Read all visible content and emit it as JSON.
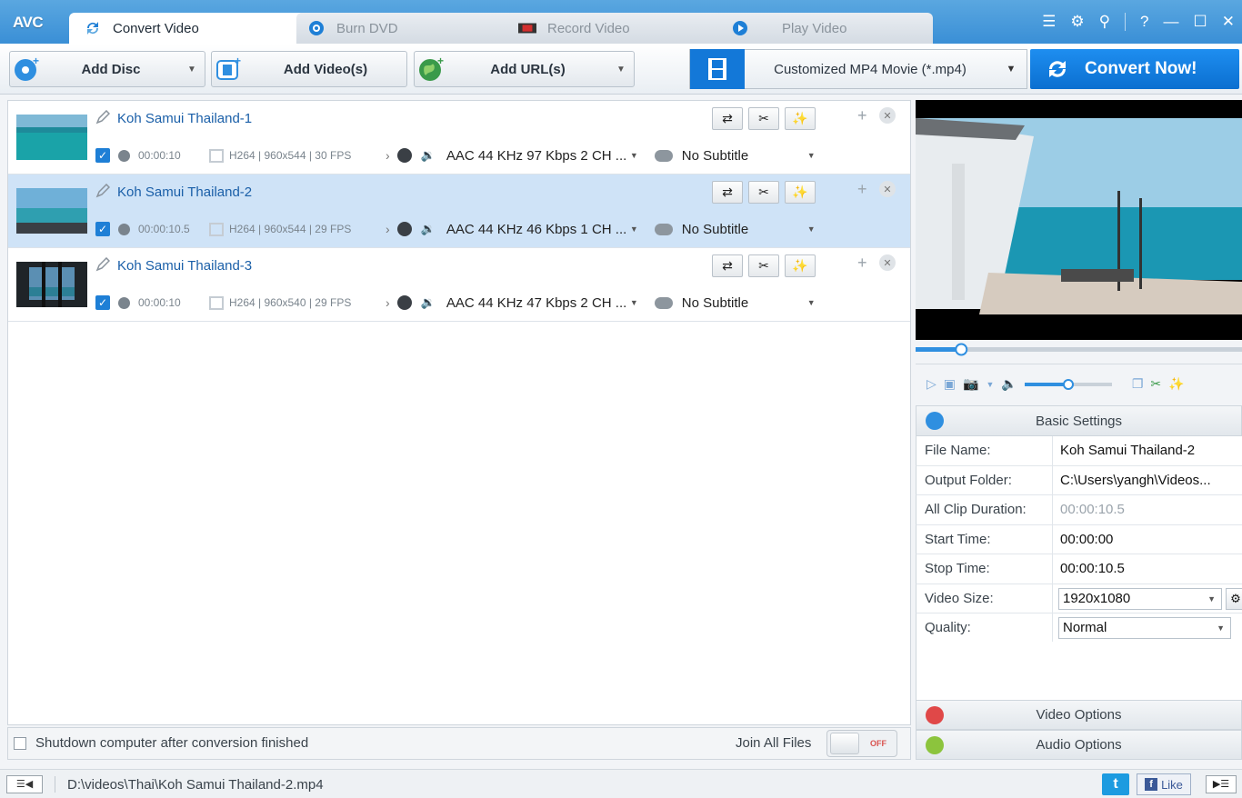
{
  "app": {
    "logo": "AVC"
  },
  "tabs": [
    {
      "label": "Convert Video",
      "icon": "refresh-arrows-icon",
      "active": true
    },
    {
      "label": "Burn DVD",
      "icon": "disc-icon",
      "active": false
    },
    {
      "label": "Record Video",
      "icon": "record-icon",
      "active": false
    },
    {
      "label": "Play Video",
      "icon": "play-icon",
      "active": false
    }
  ],
  "toolbar": {
    "add_disc": "Add Disc",
    "add_videos": "Add Video(s)",
    "add_urls": "Add URL(s)",
    "profile": "Customized MP4 Movie (*.mp4)",
    "convert": "Convert Now!"
  },
  "files": [
    {
      "title": "Koh Samui Thailand-1",
      "duration": "00:00:10",
      "video": "H264 | 960x544 | 30 FPS",
      "audio": "AAC 44 KHz 97 Kbps 2 CH ...",
      "subtitle": "No Subtitle",
      "selected": false
    },
    {
      "title": "Koh Samui Thailand-2",
      "duration": "00:00:10.5",
      "video": "H264 | 960x544 | 29 FPS",
      "audio": "AAC 44 KHz 46 Kbps 1 CH ...",
      "subtitle": "No Subtitle",
      "selected": true
    },
    {
      "title": "Koh Samui Thailand-3",
      "duration": "00:00:10",
      "video": "H264 | 960x540 | 29 FPS",
      "audio": "AAC 44 KHz 47 Kbps 2 CH ...",
      "subtitle": "No Subtitle",
      "selected": false
    }
  ],
  "bottom": {
    "shutdown": "Shutdown computer after conversion finished",
    "join": "Join All Files",
    "toggle": "OFF"
  },
  "player": {
    "seek_position": 0.14,
    "volume_level": 0.5
  },
  "settings": {
    "title": "Basic Settings",
    "rows": [
      {
        "key": "File Name:",
        "value": "Koh Samui Thailand-2"
      },
      {
        "key": "Output Folder:",
        "value": "C:\\Users\\yangh\\Videos..."
      },
      {
        "key": "All Clip Duration:",
        "value": "00:00:10.5"
      },
      {
        "key": "Start Time:",
        "value": "00:00:00"
      },
      {
        "key": "Stop Time:",
        "value": "00:00:10.5"
      },
      {
        "key": "Video Size:",
        "value": "1920x1080"
      },
      {
        "key": "Quality:",
        "value": "Normal"
      }
    ],
    "video_options": "Video Options",
    "audio_options": "Audio Options"
  },
  "status": {
    "path": "D:\\videos\\Thai\\Koh Samui Thailand-2.mp4",
    "twitter": "t",
    "like": "Like",
    "fb": "f"
  },
  "colors": {
    "accent": "#1378d8",
    "selected_row": "#cfe3f7",
    "titlebar": "#3a8fd6"
  }
}
